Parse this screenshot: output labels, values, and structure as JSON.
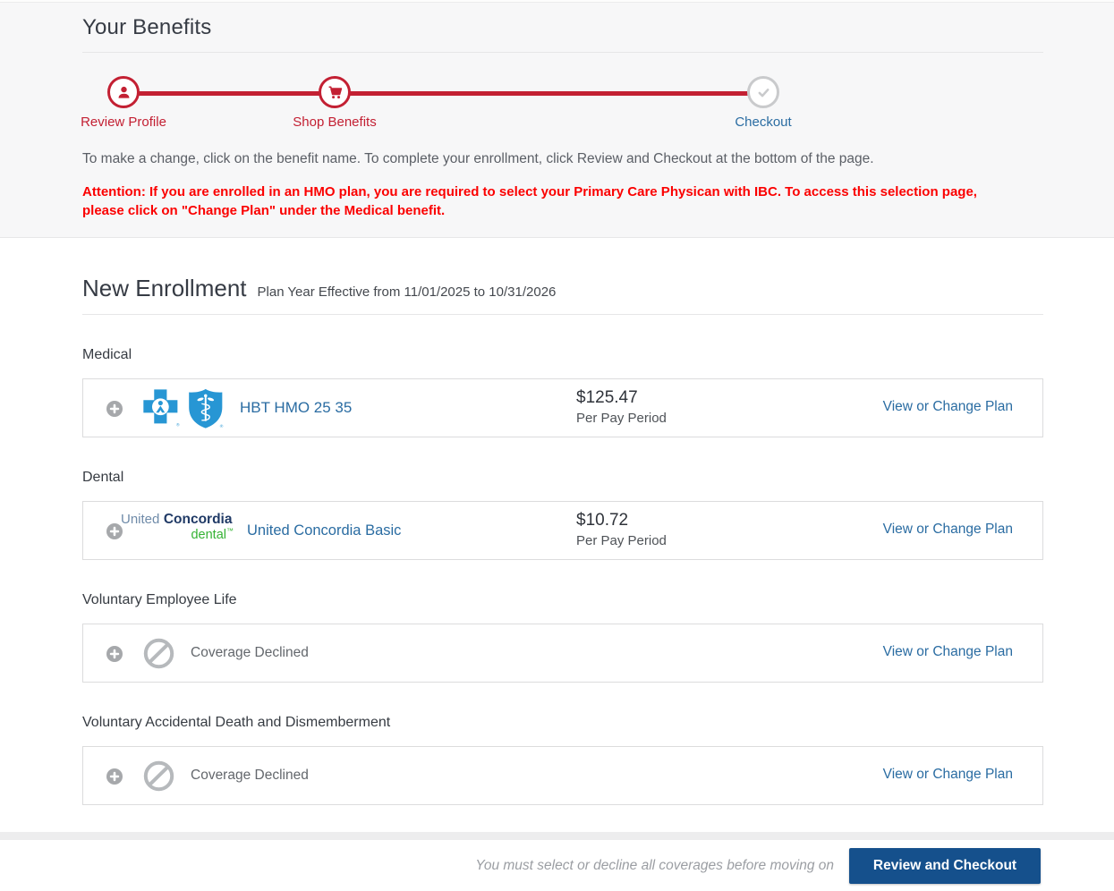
{
  "header": {
    "title": "Your Benefits"
  },
  "stepper": {
    "steps": [
      {
        "label": "Review Profile",
        "icon": "person-icon",
        "state": "complete"
      },
      {
        "label": "Shop Benefits",
        "icon": "cart-icon",
        "state": "active"
      },
      {
        "label": "Checkout",
        "icon": "check-icon",
        "state": "upcoming"
      }
    ]
  },
  "intro": {
    "instructions": "To make a change, click on the benefit name. To complete your enrollment, click Review and Checkout at the bottom of the page.",
    "attention": "Attention: If you are enrolled in an HMO plan, you are required to select your Primary Care Physican with IBC.  To access this selection page, please click on \"Change Plan\" under the Medical benefit."
  },
  "enrollment": {
    "title": "New Enrollment",
    "plan_year": "Plan Year Effective from 11/01/2025 to 10/31/2026",
    "sections": [
      {
        "name": "Medical",
        "logo": "bcbs-logo",
        "plan_name": "HBT HMO 25 35",
        "price": "$125.47",
        "price_caption": "Per Pay Period",
        "action": "View or Change Plan"
      },
      {
        "name": "Dental",
        "logo": {
          "united": "United",
          "concordia": "Concordia",
          "dental": "dental",
          "tm": "™"
        },
        "plan_name": "United Concordia Basic",
        "price": "$10.72",
        "price_caption": "Per Pay Period",
        "action": "View or Change Plan"
      },
      {
        "name": "Voluntary Employee Life",
        "status": "Coverage Declined",
        "action": "View or Change Plan"
      },
      {
        "name": "Voluntary Accidental Death and Dismemberment",
        "status": "Coverage Declined",
        "action": "View or Change Plan"
      }
    ]
  },
  "footer": {
    "notice": "You must select or decline all coverages before moving on",
    "button_label": "Review and Checkout"
  },
  "colors": {
    "accent_red": "#c32033",
    "attention_red": "#fb0000",
    "link_blue": "#2a6ca2",
    "button_navy": "#15508c",
    "bcbs_blue": "#2796d4",
    "uc_navy": "#203a66",
    "uc_green": "#35b234",
    "band_gray": "#f7f7f8"
  }
}
